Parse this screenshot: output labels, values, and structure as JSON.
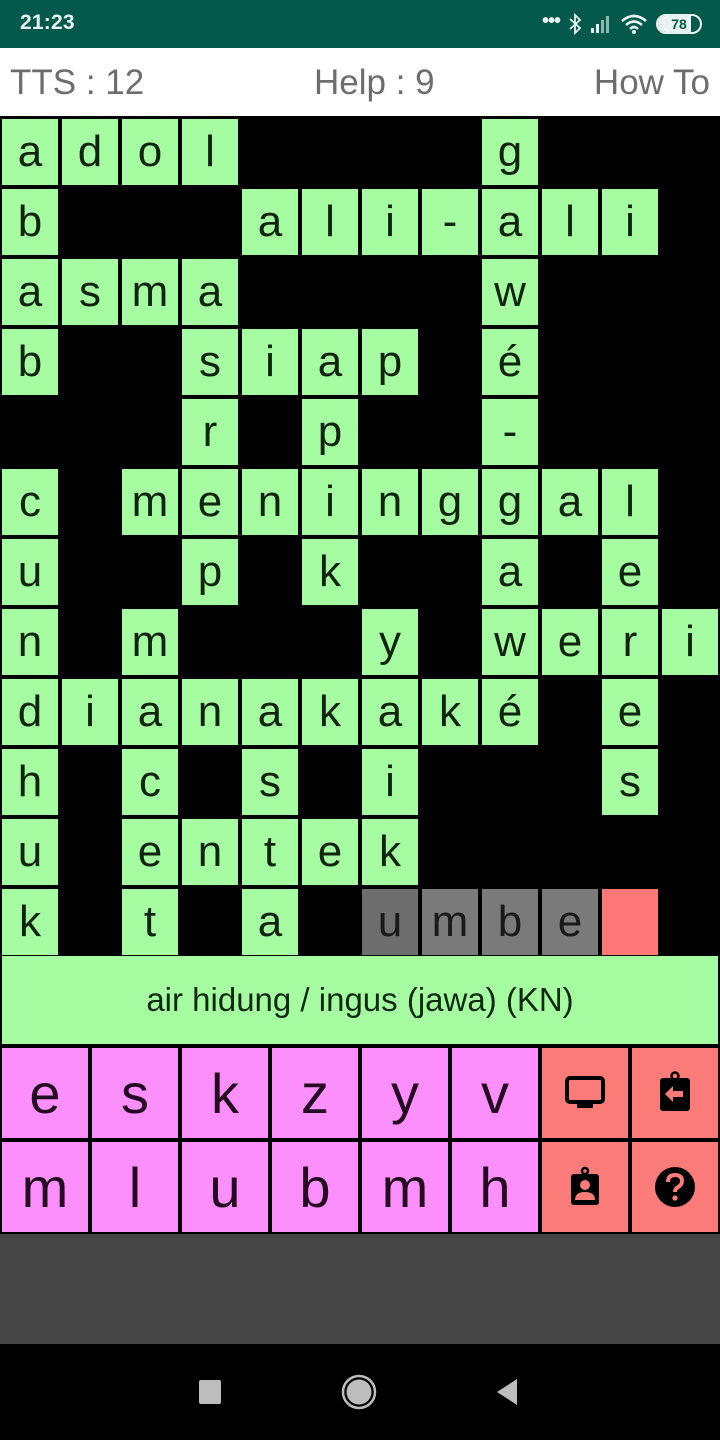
{
  "status_bar": {
    "time": "21:23",
    "overflow_dots": "•••",
    "battery_level": 78,
    "battery_label": "78",
    "icons": [
      "bluetooth-icon",
      "signal-icon",
      "wifi-icon",
      "battery-icon"
    ]
  },
  "header": {
    "tts_label": "TTS : 12",
    "help_label": "Help : 9",
    "howto_label": "How To"
  },
  "grid": {
    "rows": 12,
    "cols": 12,
    "cells": [
      "adol____g___",
      "b___ali-ali_",
      "asma____w___",
      "b__siap_é___",
      "___r_p__-___",
      "c_meninggal_",
      "u__p_k__a_e_",
      "n_m___y_weri",
      "dianakaké_e_",
      "h_c_s_i___s_",
      "u_entek_____",
      "k_t_a_umbe#_"
    ],
    "guess_cells": [
      [
        11,
        6
      ],
      [
        11,
        7
      ],
      [
        11,
        8
      ],
      [
        11,
        9
      ]
    ],
    "active_cell": [
      11,
      10
    ],
    "colors": {
      "solved": "#a5fca1",
      "guess": "#7a7a7a",
      "active": "#ff7878",
      "blank": "#000000"
    }
  },
  "clue": {
    "text": "air hidung / ingus (jawa) (KN)"
  },
  "keyboard": {
    "row1": [
      "e",
      "s",
      "k",
      "z",
      "y",
      "v"
    ],
    "row2": [
      "m",
      "l",
      "u",
      "b",
      "m",
      "h"
    ],
    "actions": [
      {
        "name": "display-button",
        "icon": "monitor-icon"
      },
      {
        "name": "back-clipboard-button",
        "icon": "clipboard-arrow-left-icon"
      },
      {
        "name": "account-badge-button",
        "icon": "badge-account-icon"
      },
      {
        "name": "help-button",
        "icon": "help-circle-icon"
      }
    ],
    "colors": {
      "letter": "#fd8ffd",
      "action": "#fb7b78"
    }
  },
  "nav_bar": {
    "buttons": [
      "recents",
      "home",
      "back"
    ]
  }
}
